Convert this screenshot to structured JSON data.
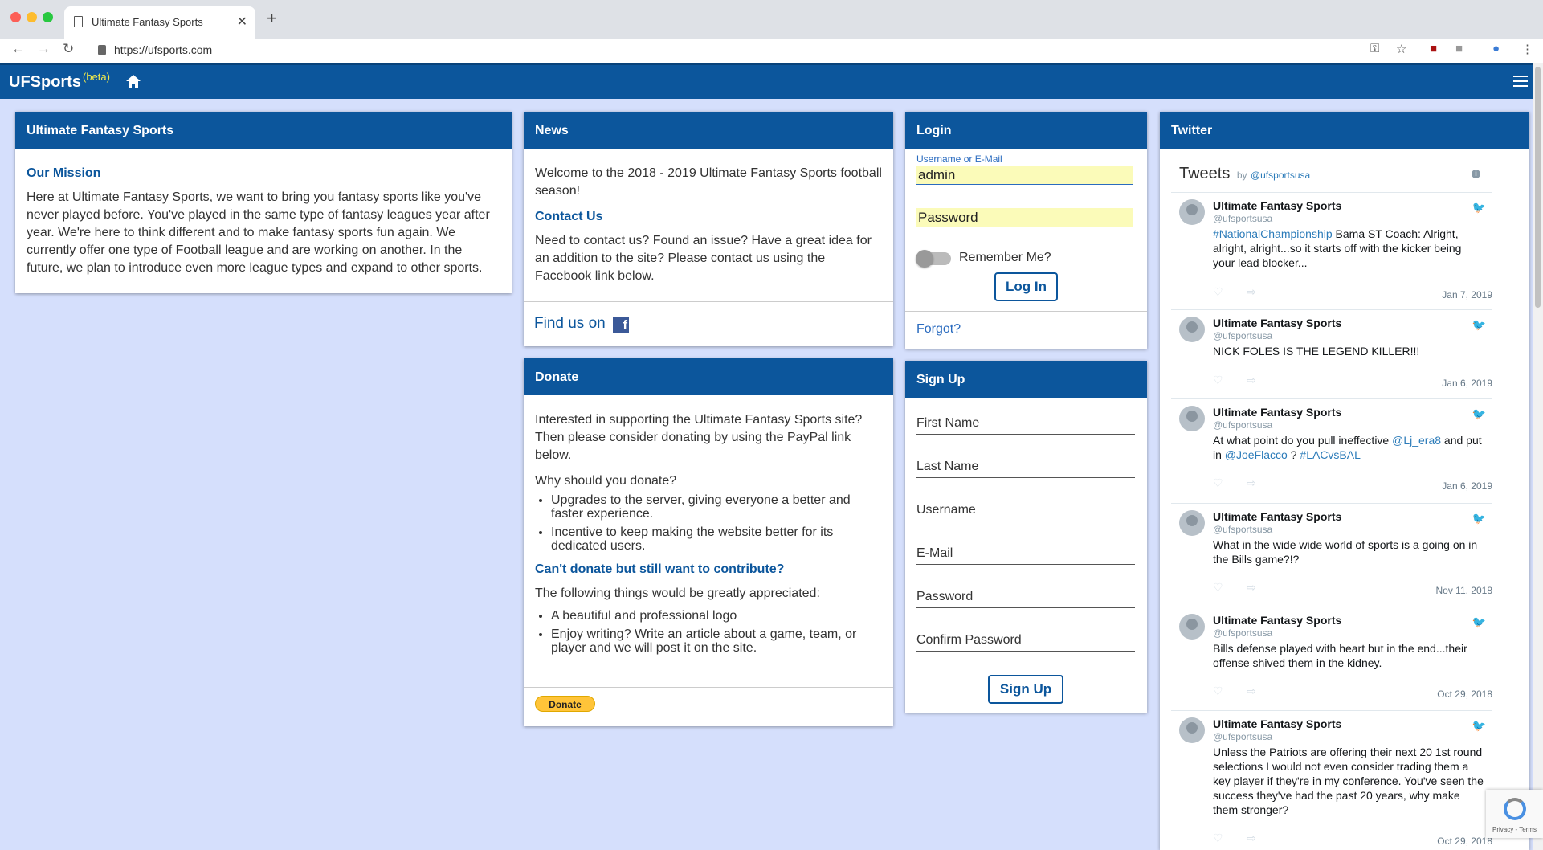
{
  "browser": {
    "tab_title": "Ultimate Fantasy Sports",
    "url": "https://ufsports.com"
  },
  "header": {
    "brand": "UFSports",
    "beta": "(beta)"
  },
  "about": {
    "title": "Ultimate Fantasy Sports",
    "mission_heading": "Our Mission",
    "mission_text": "Here at Ultimate Fantasy Sports, we want to bring you fantasy sports like you've never played before. You've played in the same type of fantasy leagues year after year. We're here to think different and to make fantasy sports fun again. We currently offer one type of Football league and are working on another. In the future, we plan to introduce even more league types and expand to other sports."
  },
  "news": {
    "title": "News",
    "welcome": "Welcome to the 2018 - 2019 Ultimate Fantasy Sports football season!",
    "contact_heading": "Contact Us",
    "contact_text": "Need to contact us? Found an issue? Have a great idea for an addition to the site? Please contact us using the Facebook link below.",
    "find_us": "Find us on"
  },
  "donate": {
    "title": "Donate",
    "intro": "Interested in supporting the Ultimate Fantasy Sports site? Then please consider donating by using the PayPal link below.",
    "why": "Why should you donate?",
    "reasons": [
      "Upgrades to the server, giving everyone a better and faster experience.",
      "Incentive to keep making the website better for its dedicated users."
    ],
    "alt_heading": "Can't donate but still want to contribute?",
    "alt_text": "The following things would be greatly appreciated:",
    "alt_items": [
      "A beautiful and professional logo",
      "Enjoy writing? Write an article about a game, team, or player and we will post it on the site."
    ],
    "button": "Donate"
  },
  "login": {
    "title": "Login",
    "username_label": "Username or E-Mail",
    "username_value": "admin",
    "password_value": "Password",
    "remember": "Remember Me?",
    "button": "Log In",
    "forgot": "Forgot?"
  },
  "signup": {
    "title": "Sign Up",
    "fields": [
      "First Name",
      "Last Name",
      "Username",
      "E-Mail",
      "Password",
      "Confirm Password"
    ],
    "button": "Sign Up"
  },
  "twitter": {
    "title": "Twitter",
    "tweets_label": "Tweets",
    "by": "by",
    "handle_link": "@ufsportsusa",
    "tweets": [
      {
        "name": "Ultimate Fantasy Sports",
        "handle": "@ufsportsusa",
        "hashtag": "#NationalChampionship",
        "text": " Bama ST Coach: Alright, alright, alright...so it starts off with the kicker being your lead blocker...",
        "date": "Jan 7, 2019"
      },
      {
        "name": "Ultimate Fantasy Sports",
        "handle": "@ufsportsusa",
        "text": "NICK FOLES IS THE LEGEND KILLER!!!",
        "date": "Jan 6, 2019"
      },
      {
        "name": "Ultimate Fantasy Sports",
        "handle": "@ufsportsusa",
        "text_a": "At what point do you pull ineffective ",
        "mention1": "@Lj_era8",
        "text_b": " and put in ",
        "mention2": "@JoeFlacco",
        "text_c": " ? ",
        "hashtag": "#LACvsBAL",
        "date": "Jan 6, 2019"
      },
      {
        "name": "Ultimate Fantasy Sports",
        "handle": "@ufsportsusa",
        "text": "What in the wide wide world of sports is a going on in the Bills game?!?",
        "date": "Nov 11, 2018"
      },
      {
        "name": "Ultimate Fantasy Sports",
        "handle": "@ufsportsusa",
        "text": "Bills defense played with heart but in the end...their offense shived them in the kidney.",
        "date": "Oct 29, 2018"
      },
      {
        "name": "Ultimate Fantasy Sports",
        "handle": "@ufsportsusa",
        "text": "Unless the Patriots are offering their next 20 1st round selections I would not even consider trading them a key player if they're in my conference. You've seen the success they've had the past 20 years, why make them stronger?",
        "date": "Oct 29, 2018"
      }
    ]
  },
  "recaptcha": {
    "text": "Privacy - Terms"
  }
}
